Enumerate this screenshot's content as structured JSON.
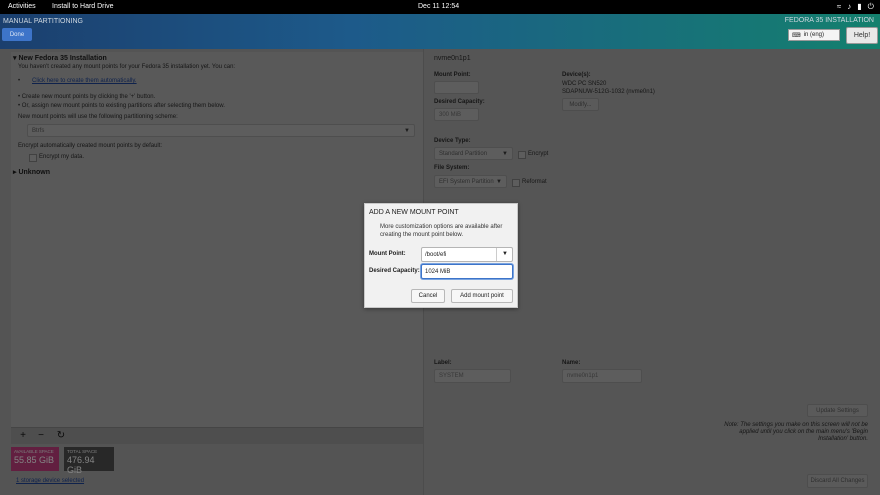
{
  "topbar": {
    "activities": "Activities",
    "app": "Install to Hard Drive",
    "clock": "Dec 11  12:54",
    "tray_icons": [
      "network-icon",
      "volume-icon",
      "battery-icon",
      "power-icon"
    ]
  },
  "header": {
    "screen_title": "MANUAL PARTITIONING",
    "done": "Done",
    "installation": "FEDORA 35 INSTALLATION",
    "keyboard": "in (eng)",
    "help": "Help!"
  },
  "left": {
    "section_new": "New Fedora 35 Installation",
    "intro": "You haven't created any mount points for your Fedora 35 installation yet.  You can:",
    "auto_link": "Click here to create them automatically.",
    "bullet1": "Create new mount points by clicking the '+' button.",
    "bullet2": "Or, assign new mount points to existing partitions after selecting them below.",
    "scheme_label": "New mount points will use the following partitioning scheme:",
    "scheme_value": "Btrfs",
    "encrypt_note": "Encrypt automatically created mount points by default:",
    "encrypt_label": "Encrypt my data.",
    "section_unknown": "Unknown",
    "available_label": "AVAILABLE SPACE",
    "available_value": "55.85 GiB",
    "total_label": "TOTAL SPACE",
    "total_value": "476.94 GiB",
    "storage_link": "1 storage device selected"
  },
  "right": {
    "partition": "nvme0n1p1",
    "mount_point_label": "Mount Point:",
    "desired_label": "Desired Capacity:",
    "desired_value": "300 MiB",
    "devices_label": "Device(s):",
    "device_line1": "WDC PC SN520",
    "device_line2": "SDAPNUW-512G-1032 (nvme0n1)",
    "modify": "Modify...",
    "device_type_label": "Device Type:",
    "device_type_value": "Standard Partition",
    "encrypt": "Encrypt",
    "fs_label": "File System:",
    "fs_value": "EFI System Partition",
    "reformat": "Reformat",
    "label_label": "Label:",
    "label_value": "SYSTEM",
    "name_label": "Name:",
    "name_value": "nvme0n1p1",
    "update": "Update Settings",
    "note": "Note:  The settings you make on this screen will not be applied until you click on the main menu's 'Begin Installation' button.",
    "discard": "Discard All Changes"
  },
  "dialog": {
    "title": "ADD A NEW MOUNT POINT",
    "desc": "More customization options are available after creating the mount point below.",
    "mount_label": "Mount Point:",
    "mount_value": "/boot/efi",
    "capacity_label": "Desired Capacity:",
    "capacity_value": "1024 MiB",
    "cancel": "Cancel",
    "add": "Add mount point"
  },
  "colors": {
    "available_bg": "#b23a75",
    "total_bg": "#4a4a4a",
    "dialog_focus": "#3d74c9",
    "done_button": "#3d74c9"
  }
}
